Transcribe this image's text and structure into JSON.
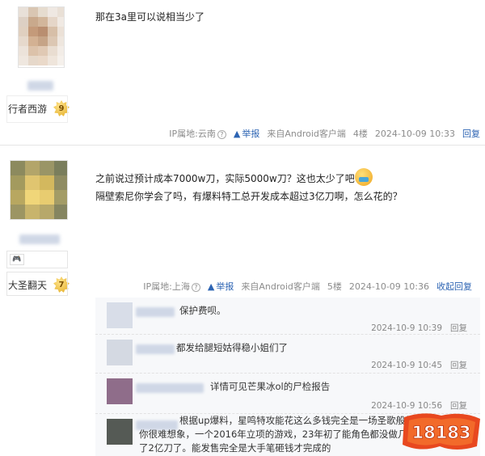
{
  "posts": [
    {
      "author_title": "行者西游",
      "level": "9",
      "content_lines": [
        "那在3a里可以说相当少了"
      ],
      "tail": {
        "ip": "IP属地:云南",
        "report": "举报",
        "source": "来自Android客户端",
        "floor": "4楼",
        "time": "2024-10-09 10:33",
        "reply": "回复"
      }
    },
    {
      "author_title": "大圣翻天",
      "level": "7",
      "content_lines": [
        "之前说过预计成本7000w刀，实际5000w刀？这也太少了吧",
        "隔壁索尼你学会了吗，有爆料特工总开发成本超过3亿刀啊，怎么花的？"
      ],
      "tail": {
        "ip": "IP属地:上海",
        "report": "举报",
        "source": "来自Android客户端",
        "floor": "5楼",
        "time": "2024-10-09 10:36",
        "reply": "收起回复"
      },
      "sub_replies": [
        {
          "text": "保护费呗。",
          "time": "2024-10-9 10:39",
          "reply": "回复"
        },
        {
          "text": "都发给腿短姑得稳小姐们了",
          "time": "2024-10-9 10:45",
          "reply": "回复"
        },
        {
          "text": "详情可见芒果冰ol的尸检报告",
          "time": "2024-10-9 10:56",
          "reply": "回复"
        },
        {
          "text_lines": [
            "根据up爆料，星鸣特攻能花这么多钱完全是一场圣歌般的开发方",
            "你很难想象，一个2016年立项的游戏，23年初了能角色都没做几",
            "了2亿刀了。能发售完全是大手笔砸钱才完成的"
          ]
        }
      ]
    }
  ],
  "watermark": "18183",
  "colors": {
    "link": "#2d64b3",
    "muted": "#8c8c8c",
    "sub_bg": "#f7f8fa"
  }
}
